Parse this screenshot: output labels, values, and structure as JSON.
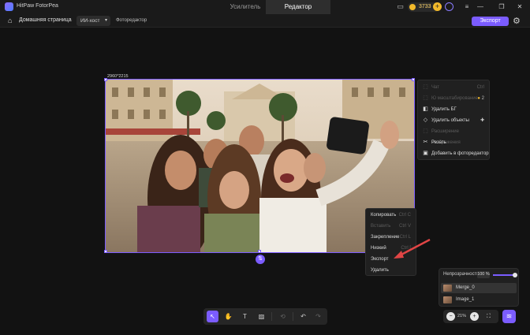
{
  "titlebar": {
    "app_title": "HitPaw FotorPea",
    "tabs": [
      {
        "label": "Усилитель",
        "active": false
      },
      {
        "label": "Редактор",
        "active": true
      }
    ],
    "credits": "3733",
    "accent": "#7b5cff"
  },
  "navbar": {
    "home_label": "Домашняя страница",
    "dropdown_value": "ИИ-хост",
    "breadcrumb": "Фоторедактор",
    "export_label": "Экспорт"
  },
  "canvas": {
    "dimensions": "2960*2215"
  },
  "side_menu": {
    "items": [
      {
        "label": "Чат",
        "shortcut": "Ctrl",
        "enabled": false,
        "icon": "chat-icon"
      },
      {
        "label": "Ю масштабирование",
        "shortcut": "2",
        "enabled": false,
        "icon": "upscale-icon"
      },
      {
        "label": "Удалить БГ",
        "shortcut": "",
        "enabled": true,
        "icon": "remove-bg-icon"
      },
      {
        "label": "Удалить объекты",
        "shortcut": "",
        "enabled": true,
        "icon": "eraser-icon"
      },
      {
        "label": "Расширение изображения",
        "shortcut": "",
        "enabled": false,
        "icon": "expand-icon"
      },
      {
        "label": "Резать",
        "shortcut": "",
        "enabled": true,
        "icon": "scissors-icon"
      },
      {
        "label": "Добавить в фоторедактор",
        "shortcut": "",
        "enabled": true,
        "icon": "add-image-icon"
      }
    ]
  },
  "context_menu": {
    "items": [
      {
        "label": "Копировать",
        "shortcut": "Ctrl C",
        "enabled": true
      },
      {
        "label": "Вставить",
        "shortcut": "Ctrl V",
        "enabled": false
      },
      {
        "label": "Закрепление",
        "shortcut": "Ctrl L",
        "enabled": true
      },
      {
        "label": "Низкий",
        "shortcut": "Ctrl [",
        "enabled": true
      },
      {
        "label": "Экспорт",
        "shortcut": "",
        "enabled": true
      },
      {
        "label": "Удалить",
        "shortcut": "",
        "enabled": true
      }
    ]
  },
  "layers": {
    "opacity_label": "Непрозрачность",
    "opacity_value": "100 %",
    "opacity_fraction": 1.0,
    "rows": [
      {
        "name": "Merge_0",
        "selected": true
      },
      {
        "name": "Image_1",
        "selected": false
      }
    ]
  },
  "zoom": {
    "value": "21%"
  }
}
